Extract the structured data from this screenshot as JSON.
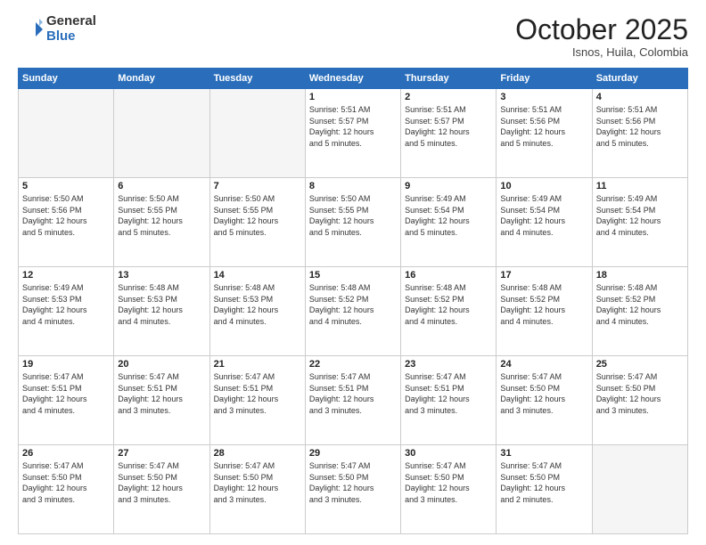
{
  "header": {
    "logo_general": "General",
    "logo_blue": "Blue",
    "month": "October 2025",
    "location": "Isnos, Huila, Colombia"
  },
  "weekdays": [
    "Sunday",
    "Monday",
    "Tuesday",
    "Wednesday",
    "Thursday",
    "Friday",
    "Saturday"
  ],
  "weeks": [
    [
      {
        "day": "",
        "info": ""
      },
      {
        "day": "",
        "info": ""
      },
      {
        "day": "",
        "info": ""
      },
      {
        "day": "1",
        "info": "Sunrise: 5:51 AM\nSunset: 5:57 PM\nDaylight: 12 hours\nand 5 minutes."
      },
      {
        "day": "2",
        "info": "Sunrise: 5:51 AM\nSunset: 5:57 PM\nDaylight: 12 hours\nand 5 minutes."
      },
      {
        "day": "3",
        "info": "Sunrise: 5:51 AM\nSunset: 5:56 PM\nDaylight: 12 hours\nand 5 minutes."
      },
      {
        "day": "4",
        "info": "Sunrise: 5:51 AM\nSunset: 5:56 PM\nDaylight: 12 hours\nand 5 minutes."
      }
    ],
    [
      {
        "day": "5",
        "info": "Sunrise: 5:50 AM\nSunset: 5:56 PM\nDaylight: 12 hours\nand 5 minutes."
      },
      {
        "day": "6",
        "info": "Sunrise: 5:50 AM\nSunset: 5:55 PM\nDaylight: 12 hours\nand 5 minutes."
      },
      {
        "day": "7",
        "info": "Sunrise: 5:50 AM\nSunset: 5:55 PM\nDaylight: 12 hours\nand 5 minutes."
      },
      {
        "day": "8",
        "info": "Sunrise: 5:50 AM\nSunset: 5:55 PM\nDaylight: 12 hours\nand 5 minutes."
      },
      {
        "day": "9",
        "info": "Sunrise: 5:49 AM\nSunset: 5:54 PM\nDaylight: 12 hours\nand 5 minutes."
      },
      {
        "day": "10",
        "info": "Sunrise: 5:49 AM\nSunset: 5:54 PM\nDaylight: 12 hours\nand 4 minutes."
      },
      {
        "day": "11",
        "info": "Sunrise: 5:49 AM\nSunset: 5:54 PM\nDaylight: 12 hours\nand 4 minutes."
      }
    ],
    [
      {
        "day": "12",
        "info": "Sunrise: 5:49 AM\nSunset: 5:53 PM\nDaylight: 12 hours\nand 4 minutes."
      },
      {
        "day": "13",
        "info": "Sunrise: 5:48 AM\nSunset: 5:53 PM\nDaylight: 12 hours\nand 4 minutes."
      },
      {
        "day": "14",
        "info": "Sunrise: 5:48 AM\nSunset: 5:53 PM\nDaylight: 12 hours\nand 4 minutes."
      },
      {
        "day": "15",
        "info": "Sunrise: 5:48 AM\nSunset: 5:52 PM\nDaylight: 12 hours\nand 4 minutes."
      },
      {
        "day": "16",
        "info": "Sunrise: 5:48 AM\nSunset: 5:52 PM\nDaylight: 12 hours\nand 4 minutes."
      },
      {
        "day": "17",
        "info": "Sunrise: 5:48 AM\nSunset: 5:52 PM\nDaylight: 12 hours\nand 4 minutes."
      },
      {
        "day": "18",
        "info": "Sunrise: 5:48 AM\nSunset: 5:52 PM\nDaylight: 12 hours\nand 4 minutes."
      }
    ],
    [
      {
        "day": "19",
        "info": "Sunrise: 5:47 AM\nSunset: 5:51 PM\nDaylight: 12 hours\nand 4 minutes."
      },
      {
        "day": "20",
        "info": "Sunrise: 5:47 AM\nSunset: 5:51 PM\nDaylight: 12 hours\nand 3 minutes."
      },
      {
        "day": "21",
        "info": "Sunrise: 5:47 AM\nSunset: 5:51 PM\nDaylight: 12 hours\nand 3 minutes."
      },
      {
        "day": "22",
        "info": "Sunrise: 5:47 AM\nSunset: 5:51 PM\nDaylight: 12 hours\nand 3 minutes."
      },
      {
        "day": "23",
        "info": "Sunrise: 5:47 AM\nSunset: 5:51 PM\nDaylight: 12 hours\nand 3 minutes."
      },
      {
        "day": "24",
        "info": "Sunrise: 5:47 AM\nSunset: 5:50 PM\nDaylight: 12 hours\nand 3 minutes."
      },
      {
        "day": "25",
        "info": "Sunrise: 5:47 AM\nSunset: 5:50 PM\nDaylight: 12 hours\nand 3 minutes."
      }
    ],
    [
      {
        "day": "26",
        "info": "Sunrise: 5:47 AM\nSunset: 5:50 PM\nDaylight: 12 hours\nand 3 minutes."
      },
      {
        "day": "27",
        "info": "Sunrise: 5:47 AM\nSunset: 5:50 PM\nDaylight: 12 hours\nand 3 minutes."
      },
      {
        "day": "28",
        "info": "Sunrise: 5:47 AM\nSunset: 5:50 PM\nDaylight: 12 hours\nand 3 minutes."
      },
      {
        "day": "29",
        "info": "Sunrise: 5:47 AM\nSunset: 5:50 PM\nDaylight: 12 hours\nand 3 minutes."
      },
      {
        "day": "30",
        "info": "Sunrise: 5:47 AM\nSunset: 5:50 PM\nDaylight: 12 hours\nand 3 minutes."
      },
      {
        "day": "31",
        "info": "Sunrise: 5:47 AM\nSunset: 5:50 PM\nDaylight: 12 hours\nand 2 minutes."
      },
      {
        "day": "",
        "info": ""
      }
    ]
  ]
}
